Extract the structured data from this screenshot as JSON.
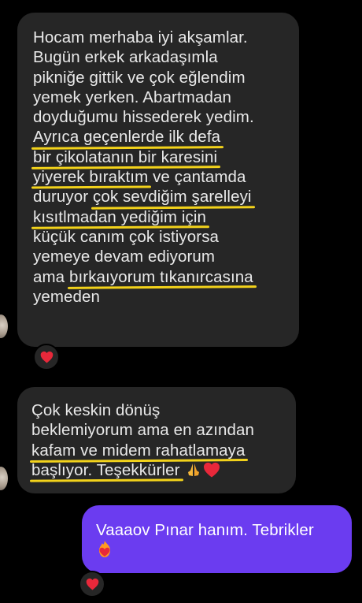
{
  "messages": [
    {
      "sender": "other",
      "lines": [
        "Hocam merhaba iyi akşamlar.",
        "Bugün erkek arkadaşımla",
        "pikniğe gittik ve çok eğlendim",
        "yemek yerken. Abartmadan",
        "doyduğumu hissederek yedim.",
        "Ayrıca geçenlerde ilk defa",
        "bir çikolatanın bir karesini",
        "yiyerek bıraktım",
        "ve çantamda",
        "duruyor",
        "çok sevdiğim şarelleyi",
        "kısıtlmadan yediğim için",
        "küçük canım çok istiyorsa",
        "yemeye devam ediyorum",
        "ama",
        "bırkaıyorum tıkanırcasına",
        "yemeden"
      ],
      "reaction": "red-heart"
    },
    {
      "sender": "other",
      "lines": [
        "Çok keskin dönüş",
        "beklemiyorum ama en azından",
        "kafam ve midem rahatlamaya",
        "başlıyor. Teşekkürler"
      ],
      "emojis": [
        "folded-hands-emoji",
        "red-heart-emoji"
      ]
    },
    {
      "sender": "me",
      "lines": [
        "Vaaaov Pınar hanım. Tebrikler"
      ],
      "emojis": [
        "heart-on-fire-emoji"
      ],
      "reaction": "red-heart"
    }
  ],
  "colors": {
    "background": "#000000",
    "incoming_bubble": "#262626",
    "outgoing_bubble": "#6b3cf0",
    "highlight_underline": "#f2d21b",
    "heart": "#e8283a"
  }
}
